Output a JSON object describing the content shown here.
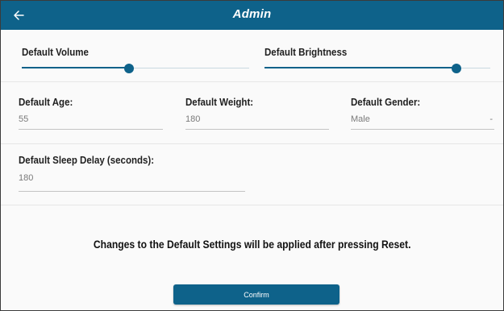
{
  "app_bar": {
    "title": "Admin",
    "back_icon": "arrow-left-icon",
    "color": "#0e628a"
  },
  "audio_display": {
    "volume_label": "Default Volume",
    "volume_level": 0.47,
    "brightness_label": "Default Brightness",
    "brightness_level": 0.85
  },
  "profile": {
    "age_label": "Default Age:",
    "age_value": "55",
    "weight_label": "Default Weight:",
    "weight_value": "180",
    "gender_label": "Default Gender:",
    "gender_value": "Male",
    "gender_caret": "-"
  },
  "sleep": {
    "label": "Default Sleep Delay (seconds):",
    "value": "180"
  },
  "notice": "Changes to the Default Settings will be applied after pressing Reset.",
  "confirm_label": "Confirm"
}
